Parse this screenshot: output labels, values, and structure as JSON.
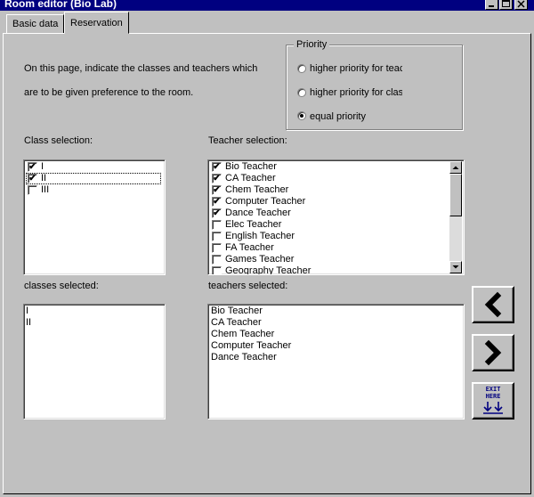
{
  "window": {
    "title": "Room editor (Bio Lab)"
  },
  "tabs": [
    {
      "label": "Basic data"
    },
    {
      "label": "Reservation"
    }
  ],
  "intro": {
    "line1": "On this page, indicate the classes and teachers which",
    "line2": "are to be given preference to the room."
  },
  "priority": {
    "title": "Priority",
    "options": [
      {
        "label": "higher priority for teach",
        "selected": false
      },
      {
        "label": "higher priority for class",
        "selected": false
      },
      {
        "label": "equal priority",
        "selected": true
      }
    ]
  },
  "class_selection": {
    "label": "Class selection:",
    "items": [
      {
        "label": "I",
        "checked": true
      },
      {
        "label": "II",
        "checked": true
      },
      {
        "label": "III",
        "checked": false
      }
    ]
  },
  "teacher_selection": {
    "label": "Teacher selection:",
    "items": [
      {
        "label": "Bio Teacher",
        "checked": true
      },
      {
        "label": "CA Teacher",
        "checked": true
      },
      {
        "label": "Chem Teacher",
        "checked": true
      },
      {
        "label": "Computer Teacher",
        "checked": true
      },
      {
        "label": "Dance Teacher",
        "checked": true
      },
      {
        "label": "Elec Teacher",
        "checked": false
      },
      {
        "label": "English Teacher",
        "checked": false
      },
      {
        "label": "FA Teacher",
        "checked": false
      },
      {
        "label": "Games Teacher",
        "checked": false
      },
      {
        "label": "Geography Teacher",
        "checked": false
      }
    ]
  },
  "classes_selected": {
    "label": "classes selected:",
    "items": [
      "I",
      "II"
    ]
  },
  "teachers_selected": {
    "label": "teachers selected:",
    "items": [
      "Bio Teacher",
      "CA Teacher",
      "Chem Teacher",
      "Computer Teacher",
      "Dance Teacher"
    ]
  },
  "buttons": {
    "prev_icon": "chevron-left-icon",
    "next_icon": "chevron-right-icon",
    "exit": {
      "line1": "EXIT",
      "line2": "HERE"
    }
  }
}
